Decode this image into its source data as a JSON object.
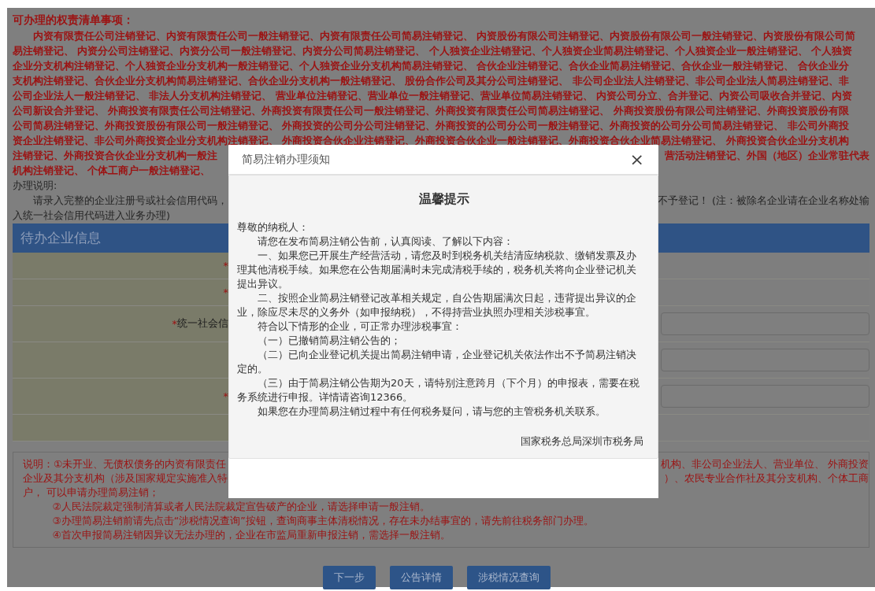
{
  "rights_list": {
    "title": "可办理的权责清单事项：",
    "lines": [
      {
        "indent": true,
        "left": "内资有限责任公司注销登记、内资有限责任公司一般注销登记、内资有限责任公司简易注销登记、 内资股份有限公司注销登记、内资股份有限公司一般注销登记、内资股份有限公司简"
      },
      {
        "indent": false,
        "left": "易注销登记、 内资分公司注销登记、内资分公司一般注销登记、内资分公司简易注销登记、 个人独资企业注销登记、个人独资企业简易注销登记、个人独资企业一般注销登记、 个人独资"
      },
      {
        "indent": false,
        "left": "企业分支机构注销登记、个人独资企业分支机构一般注销登记、个人独资企业分支机构简易注销登记、 合伙企业注销登记、合伙企业简易注销登记、合伙企业一般注销登记、 合伙企业分"
      },
      {
        "indent": false,
        "left": "支机构注销登记、合伙企业分支机构简易注销登记、合伙企业分支机构一般注销登记、 股份合作公司及其分公司注销登记、 非公司企业法人注销登记、非公司企业法人简易注销登记、非"
      },
      {
        "indent": false,
        "left": "公司企业法人一般注销登记、 非法人分支机构注销登记、 营业单位注销登记、营业单位一般注销登记、营业单位简易注销登记、 内资公司分立、合并登记、内资公司吸收合并登记、内资"
      },
      {
        "indent": false,
        "left": "公司新设合并登记、 外商投资有限责任公司注销登记、外商投资有限责任公司一般注销登记、外商投资有限责任公司简易注销登记、 外商投资股份有限公司注销登记、外商投资股份有限"
      },
      {
        "indent": false,
        "left": "公司简易注销登记、外商投资股份有限公司一般注销登记、 外商投资的公司分公司注销登记、外商投资的公司分公司一般注销登记、外商投资的公司分公司简易注销登记、 非公司外商投"
      },
      {
        "indent": false,
        "left": "资企业注销登记、非公司外商投资企业分支机构注销登记、 外商投资合伙企业注销登记、外商投资合伙企业一般注销登记、外商投资合伙企业简易注销登记、 外商投资合伙企业分支机构"
      },
      {
        "indent": false,
        "left": "注销登记、外商投资合伙企业分支机构一般注",
        "right": "营活动注销登记、外国（地区）企业常驻代表"
      },
      {
        "indent": false,
        "left": "机构注销登记、 个体工商户一般注销登记、"
      }
    ]
  },
  "instructions": {
    "title": "办理说明:",
    "lines": [
      {
        "indent": true,
        "left": "请录入完整的企业注册号或社会信用代码，",
        "right": "不予登记！ (注：被除名企业请在企业名称处输"
      },
      {
        "indent": false,
        "left": "入统一社会信用代码进入业务办理)"
      }
    ]
  },
  "form": {
    "title": "待办企业信息",
    "rows": [
      {
        "marker": "*",
        "field": false
      },
      {
        "marker": "*",
        "field": false
      },
      {
        "marker": "*",
        "label": "统一社会信",
        "field": true
      },
      {
        "field": true
      },
      {
        "marker": "*",
        "field": true
      },
      {
        "field": false
      }
    ]
  },
  "notes": {
    "lines": [
      {
        "indent": false,
        "left": "说明：①未开业、无债权债务的内资有限责任",
        "right": "机构、非公司企业法人、营业单位、 外商投资"
      },
      {
        "indent": false,
        "left": "企业及其分支机构（涉及国家规定实施准入特",
        "right": "）、农民专业合作社及其分支机构、个体工商"
      },
      {
        "indent": false,
        "left": "户， 可以申请办理简易注销；"
      },
      {
        "indent": true,
        "left": "②人民法院裁定强制清算或者人民法院裁定宣告破产的企业，请选择申请一般注销。"
      },
      {
        "indent": true,
        "left": "③办理简易注销前请先点击“涉税情况查询”按钮，查询商事主体清税情况，存在未办结事宜的，请先前往税务部门办理。"
      },
      {
        "indent": true,
        "left": "④首次申报简易注销因异议无法办理的，企业在市监局重新申报注销，需选择一般注销。"
      }
    ]
  },
  "actions": [
    "下一步",
    "公告详情",
    "涉税情况查询"
  ],
  "dialog": {
    "title": "简易注销办理须知",
    "close": "×",
    "heading": "温馨提示",
    "paragraphs": [
      {
        "kind": "salutation",
        "text": "尊敬的纳税人："
      },
      {
        "kind": "paragraph",
        "text": "请您在发布简易注销公告前，认真阅读、了解以下内容："
      },
      {
        "kind": "paragraph",
        "text": "一、如果您已开展生产经营活动，请您及时到税务机关结清应纳税款、缴销发票及办理其他清税手续。如果您在公告期届满时未完成清税手续的，税务机关将向企业登记机关提出异议。"
      },
      {
        "kind": "paragraph",
        "text": "二、按照企业简易注销登记改革相关规定，自公告期届满次日起，违背提出异议的企业，除应尽未尽的义务外（如申报纳税），不得持营业执照办理相关涉税事宜。"
      },
      {
        "kind": "paragraph",
        "text": "符合以下情形的企业，可正常办理涉税事宜："
      },
      {
        "kind": "paragraph",
        "text": "（一）已撤销简易注销公告的；"
      },
      {
        "kind": "paragraph",
        "text": "（二）已向企业登记机关提出简易注销申请，企业登记机关依法作出不予简易注销决定的。"
      },
      {
        "kind": "paragraph",
        "text": "（三）由于简易注销公告期为20天，请特别注意跨月（下个月）的申报表，需要在税务系统进行申报。详情请咨询12366。"
      },
      {
        "kind": "paragraph",
        "text": "如果您在办理简易注销过程中有任何税务疑问，请与您的主管税务机关联系。"
      }
    ],
    "signature": "国家税务总局深圳市税务局"
  }
}
